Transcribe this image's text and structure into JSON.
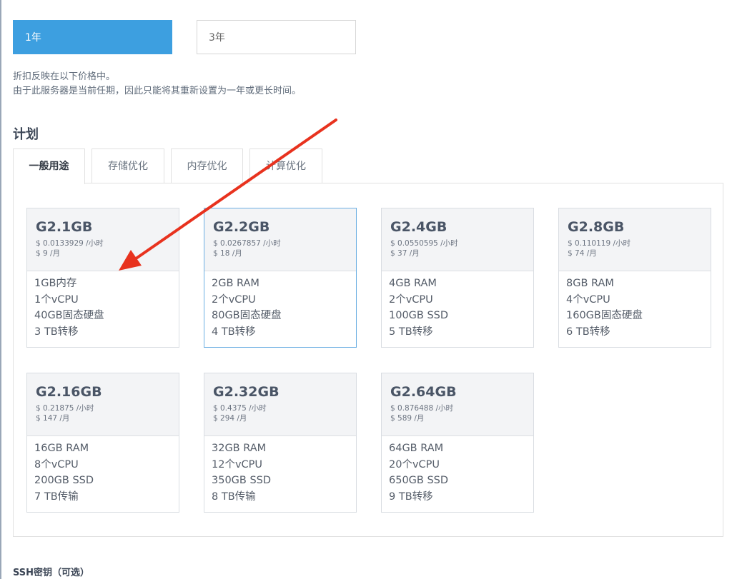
{
  "term": {
    "one_year_label": "1年",
    "three_year_label": "3年",
    "selected": "1年"
  },
  "notes": {
    "line1": "折扣反映在以下价格中。",
    "line2": "由于此服务器是当前任期，因此只能将其重新设置为一年或更长时间。"
  },
  "plan_heading": "计划",
  "tabs": [
    "一般用途",
    "存储优化",
    "内存优化",
    "计算优化"
  ],
  "active_tab": "一般用途",
  "plans": [
    {
      "name": "G2.1GB",
      "hourly": "$ 0.0133929 /小时",
      "monthly": "$ 9 /月",
      "specs": [
        "1GB内存",
        "1个vCPU",
        "40GB固态硬盘",
        "3 TB转移"
      ]
    },
    {
      "name": "G2.2GB",
      "hourly": "$ 0.0267857 /小时",
      "monthly": "$ 18 /月",
      "specs": [
        "2GB RAM",
        "2个vCPU",
        "80GB固态硬盘",
        "4 TB转移"
      ]
    },
    {
      "name": "G2.4GB",
      "hourly": "$ 0.0550595 /小时",
      "monthly": "$ 37 /月",
      "specs": [
        "4GB RAM",
        "2个vCPU",
        "100GB SSD",
        "5 TB转移"
      ]
    },
    {
      "name": "G2.8GB",
      "hourly": "$ 0.110119 /小时",
      "monthly": "$ 74 /月",
      "specs": [
        "8GB RAM",
        "4个vCPU",
        "160GB固态硬盘",
        "6 TB转移"
      ]
    },
    {
      "name": "G2.16GB",
      "hourly": "$ 0.21875 /小时",
      "monthly": "$ 147 /月",
      "specs": [
        "16GB RAM",
        "8个vCPU",
        "200GB SSD",
        "7 TB传输"
      ]
    },
    {
      "name": "G2.32GB",
      "hourly": "$ 0.4375 /小时",
      "monthly": "$ 294 /月",
      "specs": [
        "32GB RAM",
        "12个vCPU",
        "350GB SSD",
        "8 TB传输"
      ]
    },
    {
      "name": "G2.64GB",
      "hourly": "$ 0.876488 /小时",
      "monthly": "$ 589 /月",
      "specs": [
        "64GB RAM",
        "20个vCPU",
        "650GB SSD",
        "9 TB转移"
      ]
    }
  ],
  "selected_plan": "G2.2GB",
  "ssh_label": "SSH密钥（可选）",
  "colors": {
    "accent": "#3d9fe0",
    "selected_border": "#6aaee2",
    "annotation_arrow": "#e8321e"
  }
}
